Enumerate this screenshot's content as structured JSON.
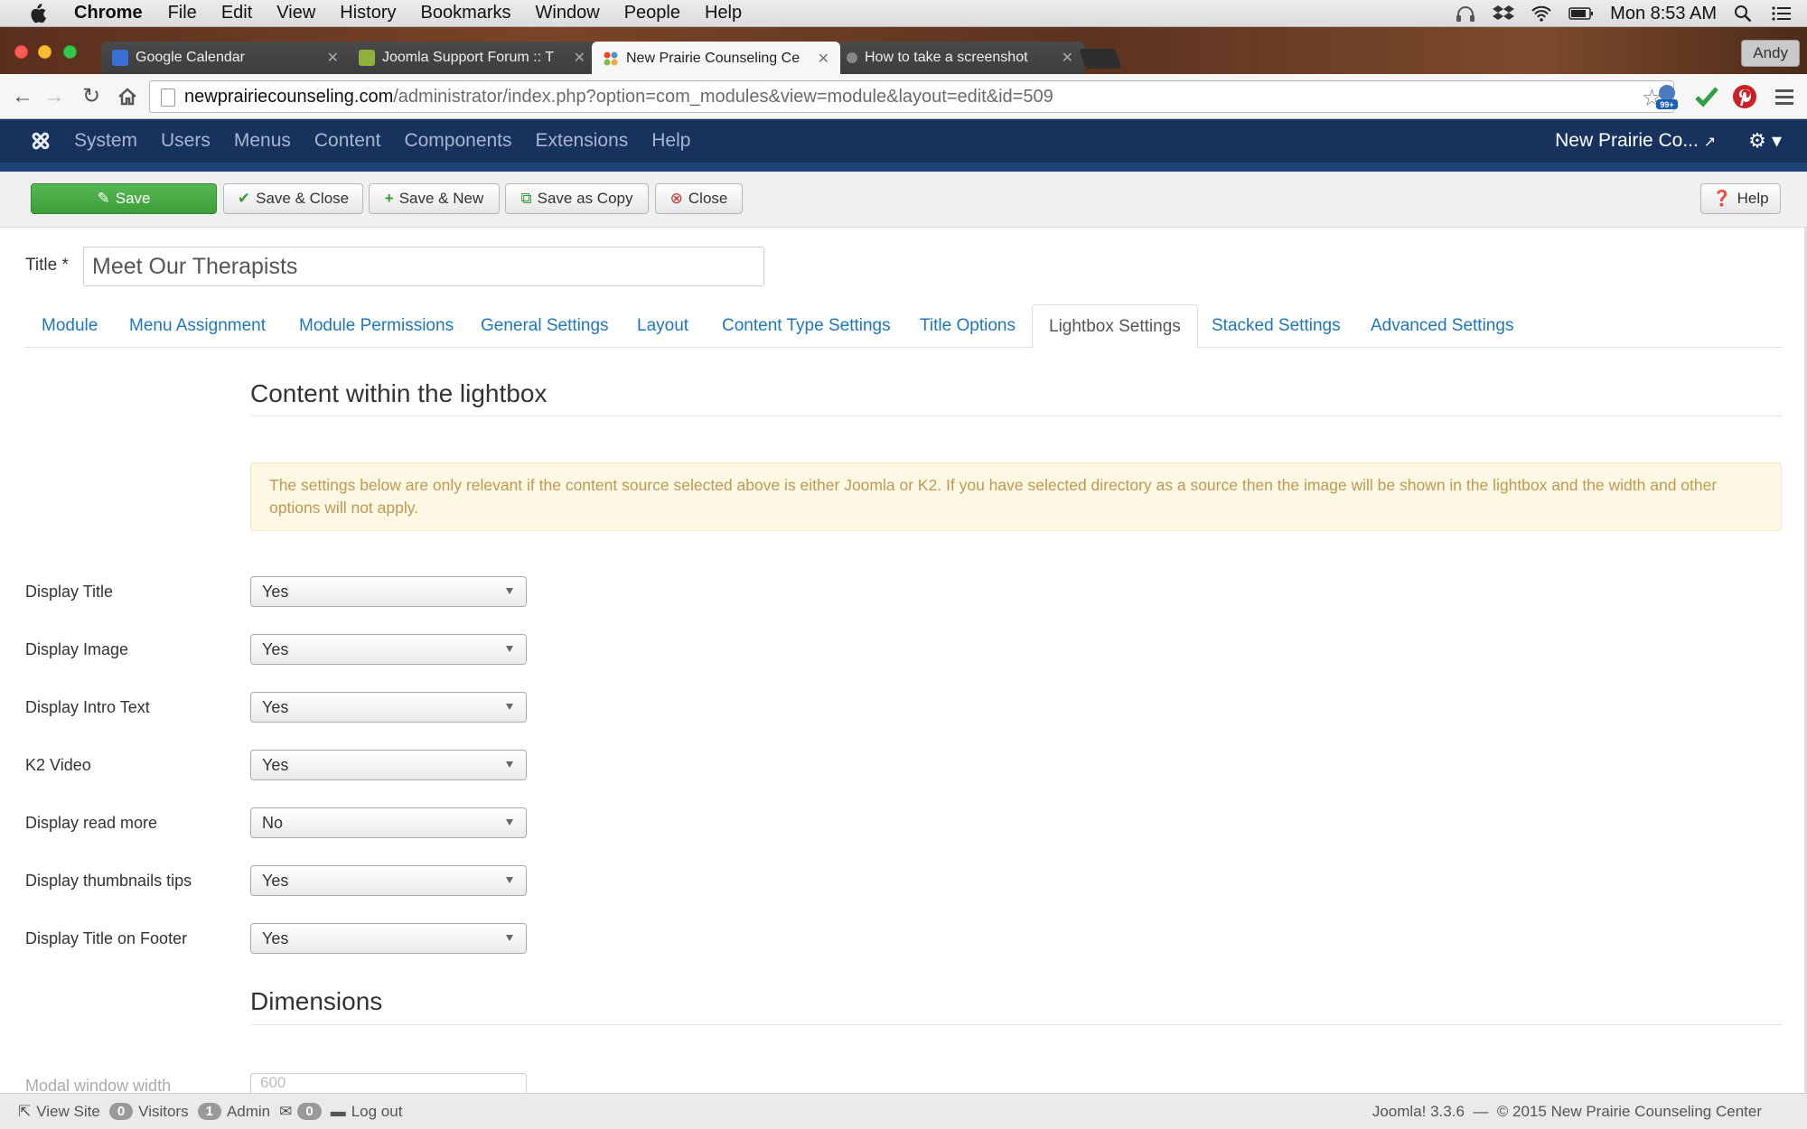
{
  "mac_menubar": {
    "app": "Chrome",
    "items": [
      "File",
      "Edit",
      "View",
      "History",
      "Bookmarks",
      "Window",
      "People",
      "Help"
    ],
    "clock": "Mon 8:53 AM"
  },
  "browser": {
    "tabs": [
      {
        "title": "Google Calendar",
        "favicon_color": "#3b6fd8"
      },
      {
        "title": "Joomla Support Forum :: T",
        "favicon_color": "#8db13a"
      },
      {
        "title": "New Prairie Counseling Ce",
        "favicon_color": "#e8772e"
      },
      {
        "title": "How to take a screenshot",
        "favicon_color": "#888888"
      }
    ],
    "profile": "Andy",
    "url_host": "newprairiecounseling.com",
    "url_path": "/administrator/index.php?option=com_modules&view=module&layout=edit&id=509",
    "extension_badge": "99+"
  },
  "joomla_nav": {
    "items": [
      "System",
      "Users",
      "Menus",
      "Content",
      "Components",
      "Extensions",
      "Help"
    ],
    "site_name": "New Prairie Co...",
    "colors": {
      "nav_bg": "#17325d",
      "sub_bg": "#1d4578"
    }
  },
  "toolbar": {
    "save": "Save",
    "save_close": "Save & Close",
    "save_new": "Save & New",
    "save_copy": "Save as Copy",
    "close": "Close",
    "help": "Help"
  },
  "form": {
    "title_label": "Title *",
    "title_value": "Meet Our Therapists",
    "tabs": [
      "Module",
      "Menu Assignment",
      "Module Permissions",
      "General Settings",
      "Layout",
      "Content Type Settings",
      "Title Options",
      "Lightbox Settings",
      "Stacked Settings",
      "Advanced Settings"
    ],
    "active_tab": "Lightbox Settings",
    "section1": "Content within the lightbox",
    "alert": "The settings below are only relevant if the content source selected above is either Joomla or K2. If you have selected directory as a source then the image will be shown in the lightbox and the width and other options will not apply.",
    "fields": [
      {
        "label": "Display Title",
        "value": "Yes"
      },
      {
        "label": "Display Image",
        "value": "Yes"
      },
      {
        "label": "Display Intro Text",
        "value": "Yes"
      },
      {
        "label": "K2 Video",
        "value": "Yes"
      },
      {
        "label": "Display read more",
        "value": "No"
      },
      {
        "label": "Display thumbnails tips",
        "value": "Yes"
      },
      {
        "label": "Display Title on Footer",
        "value": "Yes"
      }
    ],
    "section2": "Dimensions",
    "partial_field": {
      "label": "Modal window width",
      "value": "600"
    }
  },
  "statusbar": {
    "view_site": "View Site",
    "visitors_count": "0",
    "visitors": "Visitors",
    "admin_count": "1",
    "admin": "Admin",
    "messages_count": "0",
    "logout": "Log out",
    "version": "Joomla! 3.3.6",
    "sep": "—",
    "copyright": "© 2015 New Prairie Counseling Center"
  }
}
